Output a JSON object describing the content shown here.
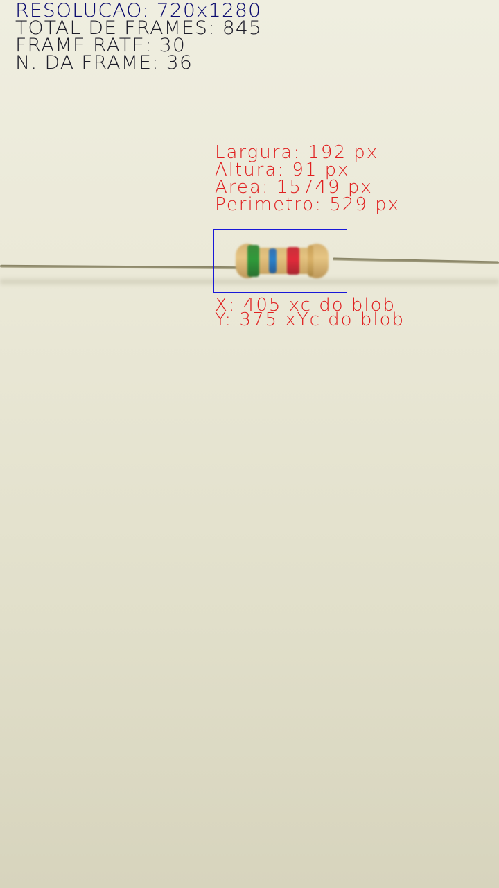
{
  "hud": {
    "resolution": "RESOLUCAO: 720x1280",
    "total_frames": "TOTAL DE FRAMES: 845",
    "frame_rate": "FRAME RATE: 30",
    "frame_number": "N. DA FRAME: 36"
  },
  "blob": {
    "width": "Largura: 192 px",
    "height": "Altura: 91 px",
    "area": "Area: 15749 px",
    "perimeter": "Perimetro: 529 px",
    "x_center": "X: 405 xc do blob",
    "y_center": "Y: 375 xYc do blob"
  },
  "colors": {
    "hud_title": "#0a0a6e",
    "hud_text": "#1e1e2a",
    "measurement_text": "#e02020",
    "bounding_box": "#1818d8",
    "background": "#ebe9d8"
  }
}
